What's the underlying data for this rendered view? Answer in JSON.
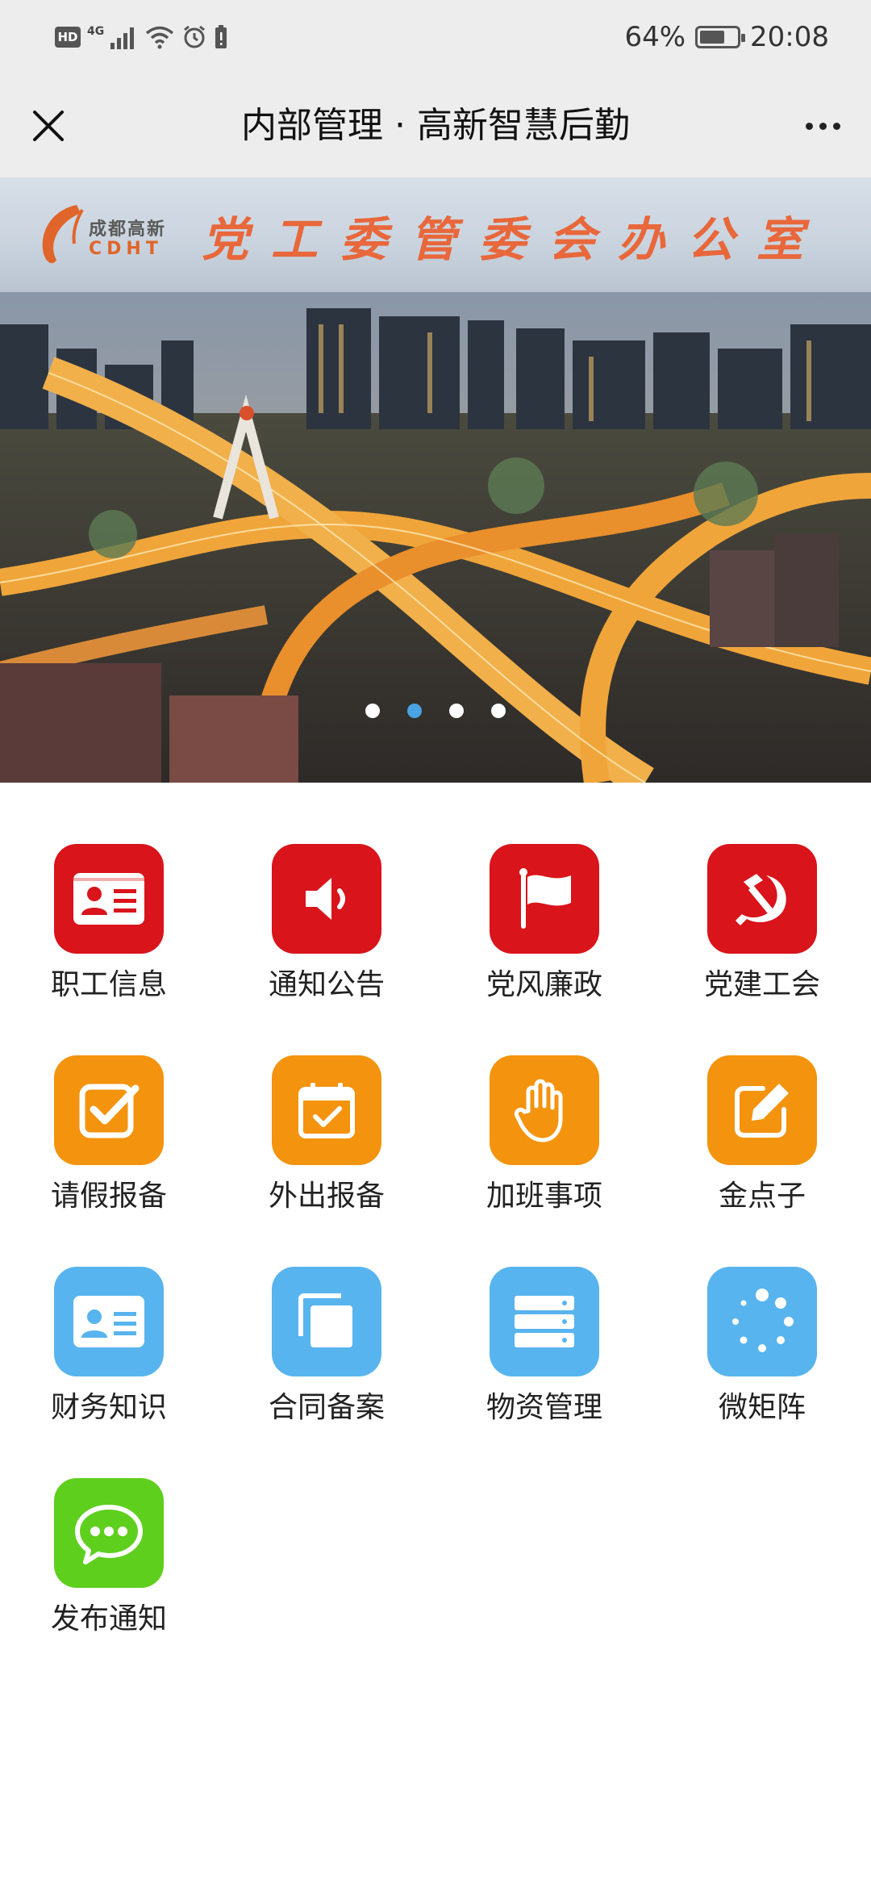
{
  "status_bar": {
    "hd": "HD",
    "network": "4G",
    "battery": "64%",
    "time": "20:08"
  },
  "title_bar": {
    "title": "内部管理 · 高新智慧后勤"
  },
  "banner": {
    "logo_cn": "成都高新",
    "logo_en": "CDHT",
    "title": "党工委管委会办公室",
    "active_slide": 2,
    "slide_count": 4
  },
  "colors": {
    "red": "#d9141b",
    "orange": "#f4930d",
    "blue": "#58b4ee",
    "green": "#5fcf1e",
    "accent_dot": "#4aa3e2"
  },
  "menu": [
    {
      "label": "职工信息",
      "icon": "id-card-icon",
      "color": "red"
    },
    {
      "label": "通知公告",
      "icon": "speaker-icon",
      "color": "red"
    },
    {
      "label": "党风廉政",
      "icon": "flag-icon",
      "color": "red"
    },
    {
      "label": "党建工会",
      "icon": "hammer-sickle-icon",
      "color": "red"
    },
    {
      "label": "请假报备",
      "icon": "checkbox-icon",
      "color": "orange"
    },
    {
      "label": "外出报备",
      "icon": "calendar-check-icon",
      "color": "orange"
    },
    {
      "label": "加班事项",
      "icon": "hand-icon",
      "color": "orange"
    },
    {
      "label": "金点子",
      "icon": "edit-icon",
      "color": "orange"
    },
    {
      "label": "财务知识",
      "icon": "id-card-icon",
      "color": "blue"
    },
    {
      "label": "合同备案",
      "icon": "copy-icon",
      "color": "blue"
    },
    {
      "label": "物资管理",
      "icon": "server-icon",
      "color": "blue"
    },
    {
      "label": "微矩阵",
      "icon": "spinner-icon",
      "color": "blue"
    },
    {
      "label": "发布通知",
      "icon": "chat-bubble-icon",
      "color": "green"
    }
  ]
}
